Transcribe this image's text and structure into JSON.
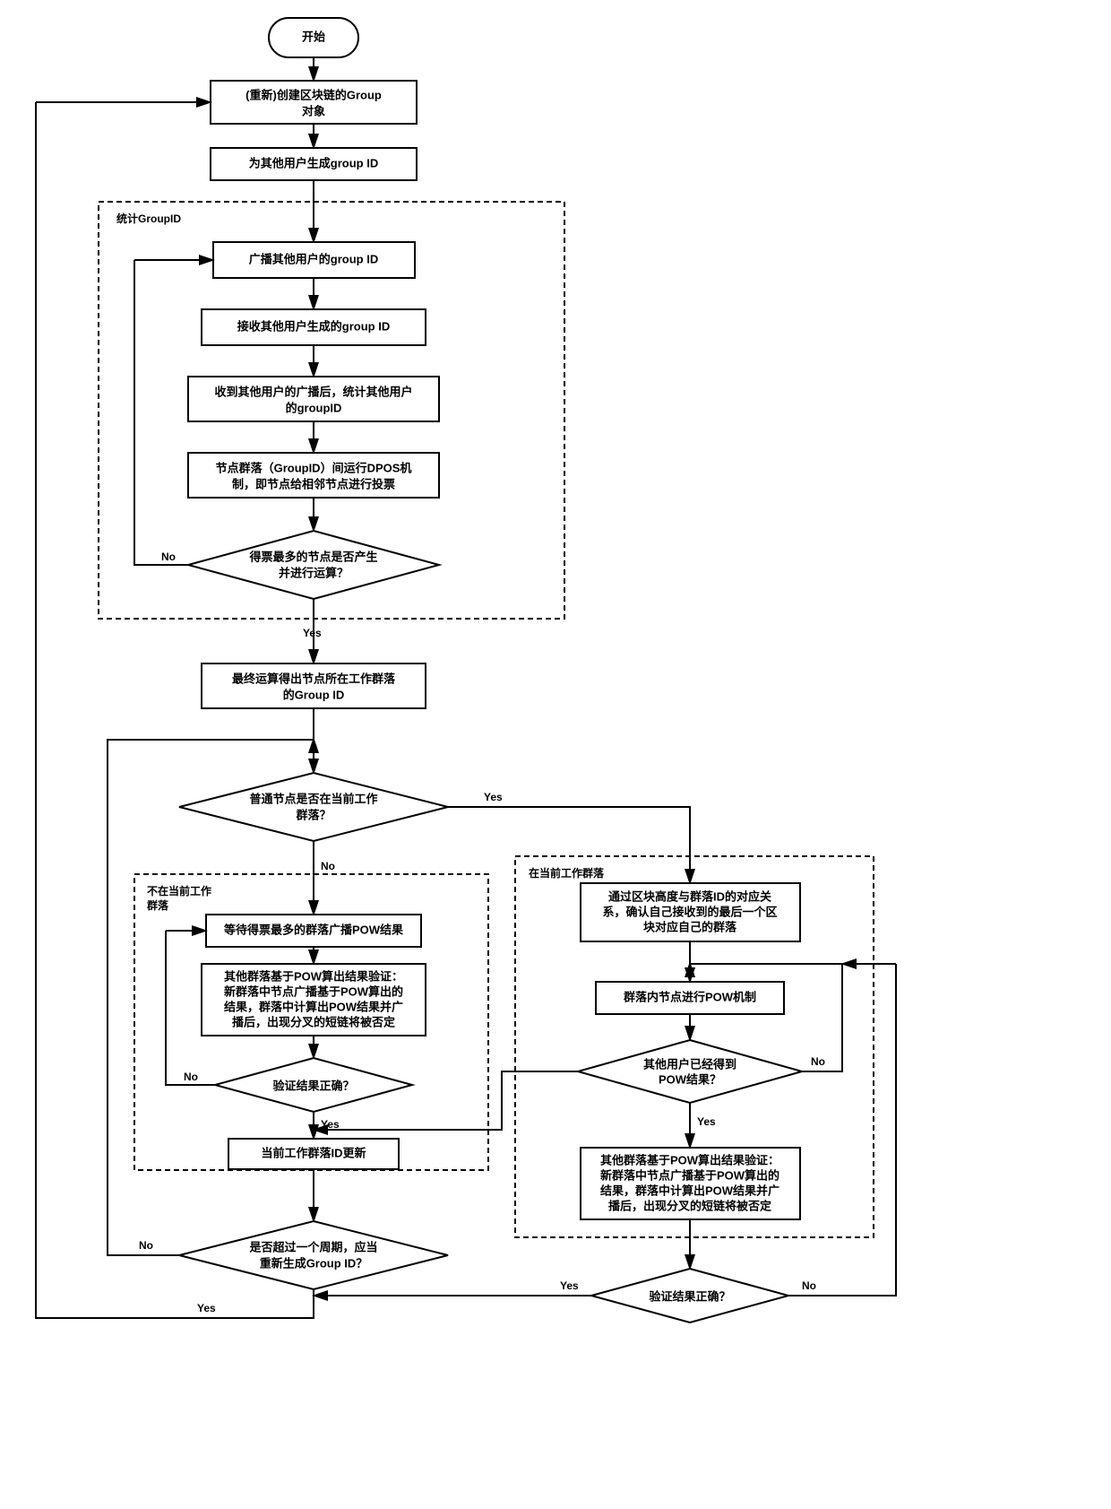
{
  "nodes": {
    "start": "开始",
    "n1a": "(重新)创建区块链的Group",
    "n1b": "对象",
    "n2": "为其他用户生成group ID",
    "group1_title": "统计GroupID",
    "n3": "广播其他用户的group ID",
    "n4": "接收其他用户生成的group ID",
    "n5a": "收到其他用户的广播后，统计其他用户",
    "n5b": "的groupID",
    "n6a": "节点群落（GroupID）间运行DPOS机",
    "n6b": "制，即节点给相邻节点进行投票",
    "d1a": "得票最多的节点是否产生",
    "d1b": "并进行运算？",
    "n7a": "最终运算得出节点所在工作群落",
    "n7b": "的Group ID",
    "d2a": "普通节点是否在当前工作",
    "d2b": "群落？",
    "group2_title": "不在当前工作",
    "group2_title2": "群落",
    "n8": "等待得票最多的群落广播POW结果",
    "n9a": "其他群落基于POW算出结果验证：",
    "n9b": "新群落中节点广播基于POW算出的",
    "n9c": "结果，群落中计算出POW结果并广",
    "n9d": "播后，出现分叉的短链将被否定",
    "d3": "验证结果正确？",
    "n10": "当前工作群落ID更新",
    "d4a": "是否超过一个周期，应当",
    "d4b": "重新生成Group ID？",
    "group3_title": "在当前工作群落",
    "n11a": "通过区块高度与群落ID的对应关",
    "n11b": "系，确认自己接收到的最后一个区",
    "n11c": "块对应自己的群落",
    "n12": "群落内节点进行POW机制",
    "d5a": "其他用户已经得到",
    "d5b": "POW结果？",
    "n13a": "其他群落基于POW算出结果验证：",
    "n13b": "新群落中节点广播基于POW算出的",
    "n13c": "结果，群落中计算出POW结果并广",
    "n13d": "播后，出现分叉的短链将被否定",
    "d6": "验证结果正确？"
  },
  "labels": {
    "yes": "Yes",
    "no": "No"
  }
}
